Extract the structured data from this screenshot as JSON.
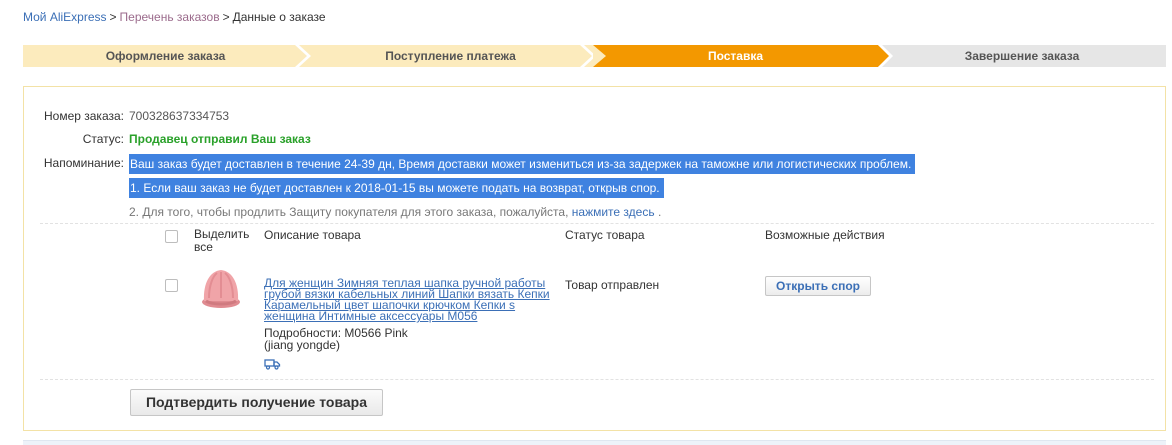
{
  "breadcrumb": {
    "home": "Мой AliExpress",
    "separator": ">",
    "orders": "Перечень заказов",
    "current": "Данные о заказе"
  },
  "steps": [
    {
      "label": "Оформление заказа",
      "state": "done"
    },
    {
      "label": "Поступление платежа",
      "state": "done"
    },
    {
      "label": "Поставка",
      "state": "active"
    },
    {
      "label": "Завершение заказа",
      "state": "pending"
    }
  ],
  "order": {
    "number_label": "Номер заказа:",
    "number_value": "700328637334753",
    "status_label": "Статус:",
    "status_value": "Продавец отправил Ваш заказ",
    "reminder_label": "Напоминание:",
    "reminder_line1": "Ваш заказ будет доставлен в течение 24-39 дн, Время доставки может измениться из-за задержек на таможне или логистических проблем.",
    "reminder_line2": "1. Если ваш заказ не будет доставлен к 2018-01-15 вы можете подать на возврат, открыв спор.",
    "reminder_line3_prefix": "2. Для того, чтобы продлить Защиту покупателя для этого заказа, пожалуйста,",
    "reminder_line3_link": "нажмите здесь",
    "reminder_line3_suffix": "."
  },
  "table": {
    "select_all": "Выделить все",
    "col_description": "Описание товара",
    "col_status": "Статус товара",
    "col_actions": "Возможные действия"
  },
  "item": {
    "title": "Для женщин Зимняя теплая шапка ручной работы грубой вязки кабельных линий Шапки вязать Кепки Карамельный цвет шапочки крючком Кепки s женщина Интимные аксессуары M056",
    "details": "Подробности: M0566 Pink",
    "seller": "(jiang yongde)",
    "status": "Товар отправлен",
    "action_label": "Открыть спор",
    "image_icon": "pink-knit-hat",
    "shipping_icon": "truck-icon"
  },
  "confirm_button": "Подтвердить получение товара",
  "colors": {
    "step_done": "#fcebbd",
    "step_active": "#f39800",
    "step_pending": "#e6e6e6",
    "link": "#3b6fb6",
    "status_green": "#2aa12a",
    "highlight": "#3f82e0"
  }
}
